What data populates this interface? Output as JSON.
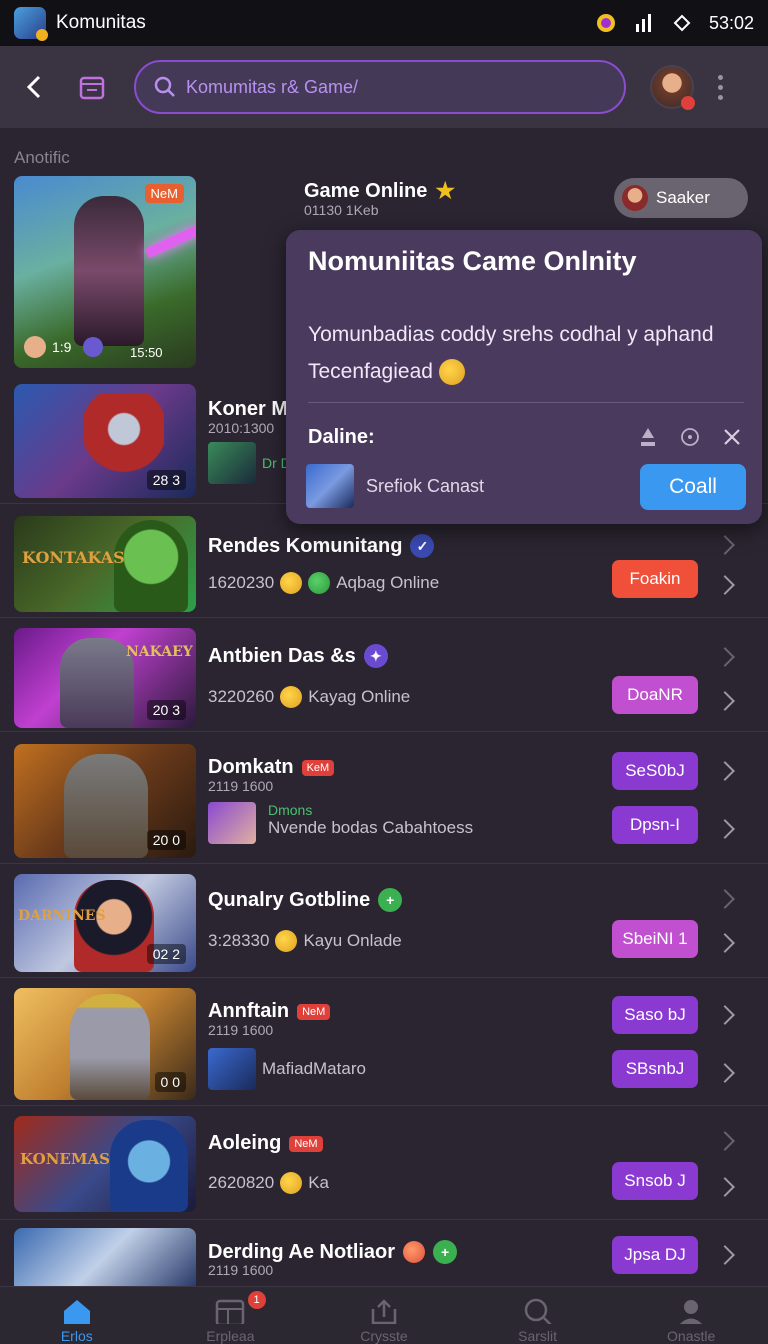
{
  "status_bar": {
    "app_name": "Komunitas",
    "time": "53:02"
  },
  "header": {
    "search_value": "",
    "search_placeholder": "Komumitas r& Game/"
  },
  "section_label": "Anotific",
  "featured": {
    "title": "Game Online",
    "subtitle": "01130 1Keb",
    "thumb_badge": "NeM",
    "thumb_count": "1:9",
    "thumb_label": "15:50",
    "chip_label": "Saaker"
  },
  "popup": {
    "title": "Nomuniitas Came Onlnity",
    "body": "Yomunbadias coddy srehs codhal y aphand Tecenfagiead",
    "label": "Daline:",
    "user": "Srefiok Canast",
    "button": "Coall"
  },
  "rows": [
    {
      "title": "Koner Mi",
      "sub": "2010:1300",
      "meta": "Dr Du",
      "thumb_label": "28 3"
    },
    {
      "title": "Rendes Komunitang",
      "meta_num": "1620230",
      "meta_text": "Aqbag Online",
      "button": "Foakin"
    },
    {
      "title": "Antbien Das &s",
      "meta_num": "3220260",
      "meta_text": "Kayag Online",
      "button": "DoaNR",
      "thumb_label": "20 3"
    },
    {
      "title": "Domkatn",
      "badge": "KeM",
      "sub": "2119 1600",
      "sub2": "Dmons",
      "meta_text": "Nvende bodas Cabahtoess",
      "button1": "SeS0bJ",
      "button2": "Dpsn-I",
      "thumb_label": "20 0"
    },
    {
      "title": "Qunalry Gotbline",
      "meta_num": "3:28330",
      "meta_text": "Kayu Onlade",
      "button": "SbeiNI 1",
      "thumb_label": "02 2"
    },
    {
      "title": "Annftain",
      "badge": "NeM",
      "sub": "2119 1600",
      "meta_text": "MafiadMataro",
      "button1": "Saso bJ",
      "button2": "SBsnbJ",
      "thumb_label": "0 0"
    },
    {
      "title": "Aoleing",
      "badge": "NeM",
      "meta_num": "2620820",
      "meta_text": "Ka",
      "button": "Snsob J"
    },
    {
      "title": "Derding Ae Notliaor",
      "sub": "2119 1600",
      "button": "Jpsa DJ"
    }
  ],
  "nav": [
    {
      "label": "Erlos"
    },
    {
      "label": "Erpleaa",
      "badge": "1"
    },
    {
      "label": "Crysste"
    },
    {
      "label": "Sarslit"
    },
    {
      "label": "Onastle"
    }
  ],
  "colors": {
    "accent": "#8a4cd0",
    "primary_button": "#3a98f0",
    "red": "#f0503a"
  }
}
